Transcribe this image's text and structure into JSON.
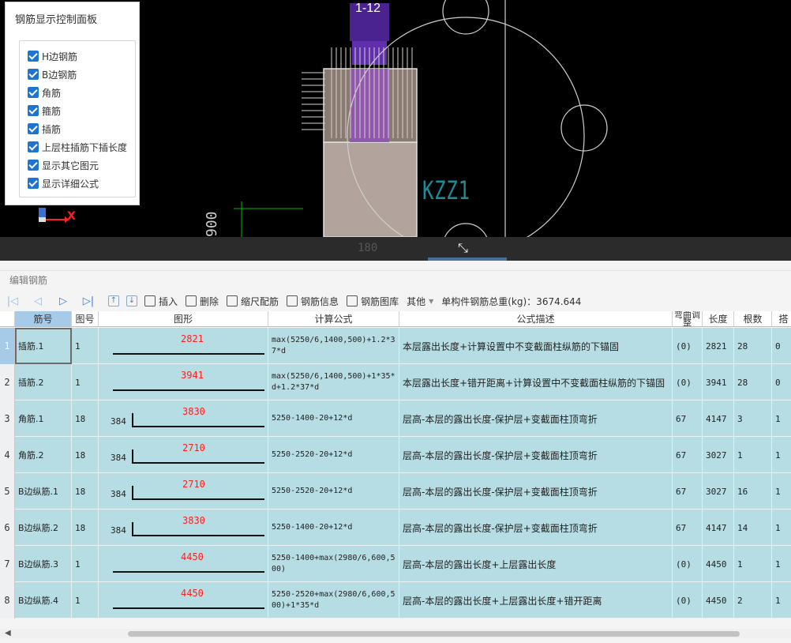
{
  "viewport": {
    "section_label": "1-12",
    "column_label": "KZZ1",
    "dim_label": "900",
    "dim_label2": "180",
    "axis_x": "X"
  },
  "panel": {
    "title": "钢筋显示控制面板",
    "options": [
      {
        "label": "H边钢筋",
        "checked": true
      },
      {
        "label": "B边钢筋",
        "checked": true
      },
      {
        "label": "角筋",
        "checked": true
      },
      {
        "label": "箍筋",
        "checked": true
      },
      {
        "label": "插筋",
        "checked": true
      },
      {
        "label": "上层柱插筋下插长度",
        "checked": true
      },
      {
        "label": "显示其它图元",
        "checked": true
      },
      {
        "label": "显示详细公式",
        "checked": true
      }
    ]
  },
  "editor": {
    "title": "编辑钢筋",
    "toolbar": {
      "insert": "插入",
      "delete": "删除",
      "scale": "缩尺配筋",
      "info": "钢筋信息",
      "library": "钢筋图库",
      "other": "其他",
      "total": "单构件钢筋总重(kg)：3674.644"
    },
    "headers": [
      "筋号",
      "图号",
      "图形",
      "计算公式",
      "公式描述",
      "弯曲调整",
      "长度",
      "根数",
      "搭"
    ],
    "rows": [
      {
        "num": "1",
        "name": "插筋.1",
        "fig": "1",
        "shape_val": "2821",
        "hook": "",
        "formula": "max(5250/6,1400,500)+1.2*37*d",
        "desc": "本层露出长度+计算设置中不变截面柱纵筋的下锚固",
        "bend": "(0)",
        "length": "2821",
        "count": "28",
        "lap": "0"
      },
      {
        "num": "2",
        "name": "插筋.2",
        "fig": "1",
        "shape_val": "3941",
        "hook": "",
        "formula": "max(5250/6,1400,500)+1*35*d+1.2*37*d",
        "desc": "本层露出长度+错开距离+计算设置中不变截面柱纵筋的下锚固",
        "bend": "(0)",
        "length": "3941",
        "count": "28",
        "lap": "0"
      },
      {
        "num": "3",
        "name": "角筋.1",
        "fig": "18",
        "shape_val": "3830",
        "hook": "384",
        "formula": "5250-1400-20+12*d",
        "desc": "层高-本层的露出长度-保护层+变截面柱顶弯折",
        "bend": "67",
        "length": "4147",
        "count": "3",
        "lap": "1"
      },
      {
        "num": "4",
        "name": "角筋.2",
        "fig": "18",
        "shape_val": "2710",
        "hook": "384",
        "formula": "5250-2520-20+12*d",
        "desc": "层高-本层的露出长度-保护层+变截面柱顶弯折",
        "bend": "67",
        "length": "3027",
        "count": "1",
        "lap": "1"
      },
      {
        "num": "5",
        "name": "B边纵筋.1",
        "fig": "18",
        "shape_val": "2710",
        "hook": "384",
        "formula": "5250-2520-20+12*d",
        "desc": "层高-本层的露出长度-保护层+变截面柱顶弯折",
        "bend": "67",
        "length": "3027",
        "count": "16",
        "lap": "1"
      },
      {
        "num": "6",
        "name": "B边纵筋.2",
        "fig": "18",
        "shape_val": "3830",
        "hook": "384",
        "formula": "5250-1400-20+12*d",
        "desc": "层高-本层的露出长度-保护层+变截面柱顶弯折",
        "bend": "67",
        "length": "4147",
        "count": "14",
        "lap": "1"
      },
      {
        "num": "7",
        "name": "B边纵筋.3",
        "fig": "1",
        "shape_val": "4450",
        "hook": "",
        "formula": "5250-1400+max(2980/6,600,500)",
        "desc": "层高-本层的露出长度+上层露出长度",
        "bend": "(0)",
        "length": "4450",
        "count": "1",
        "lap": "1"
      },
      {
        "num": "8",
        "name": "B边纵筋.4",
        "fig": "1",
        "shape_val": "4450",
        "hook": "",
        "formula": "5250-2520+max(2980/6,600,500)+1*35*d",
        "desc": "层高-本层的露出长度+上层露出长度+错开距离",
        "bend": "(0)",
        "length": "4450",
        "count": "2",
        "lap": "1"
      }
    ]
  },
  "colors": {
    "row_bg": "#b7dde4",
    "selected_header": "#a6cbe9",
    "shape_value": "#ff2020",
    "checkbox": "#1e74d0"
  }
}
